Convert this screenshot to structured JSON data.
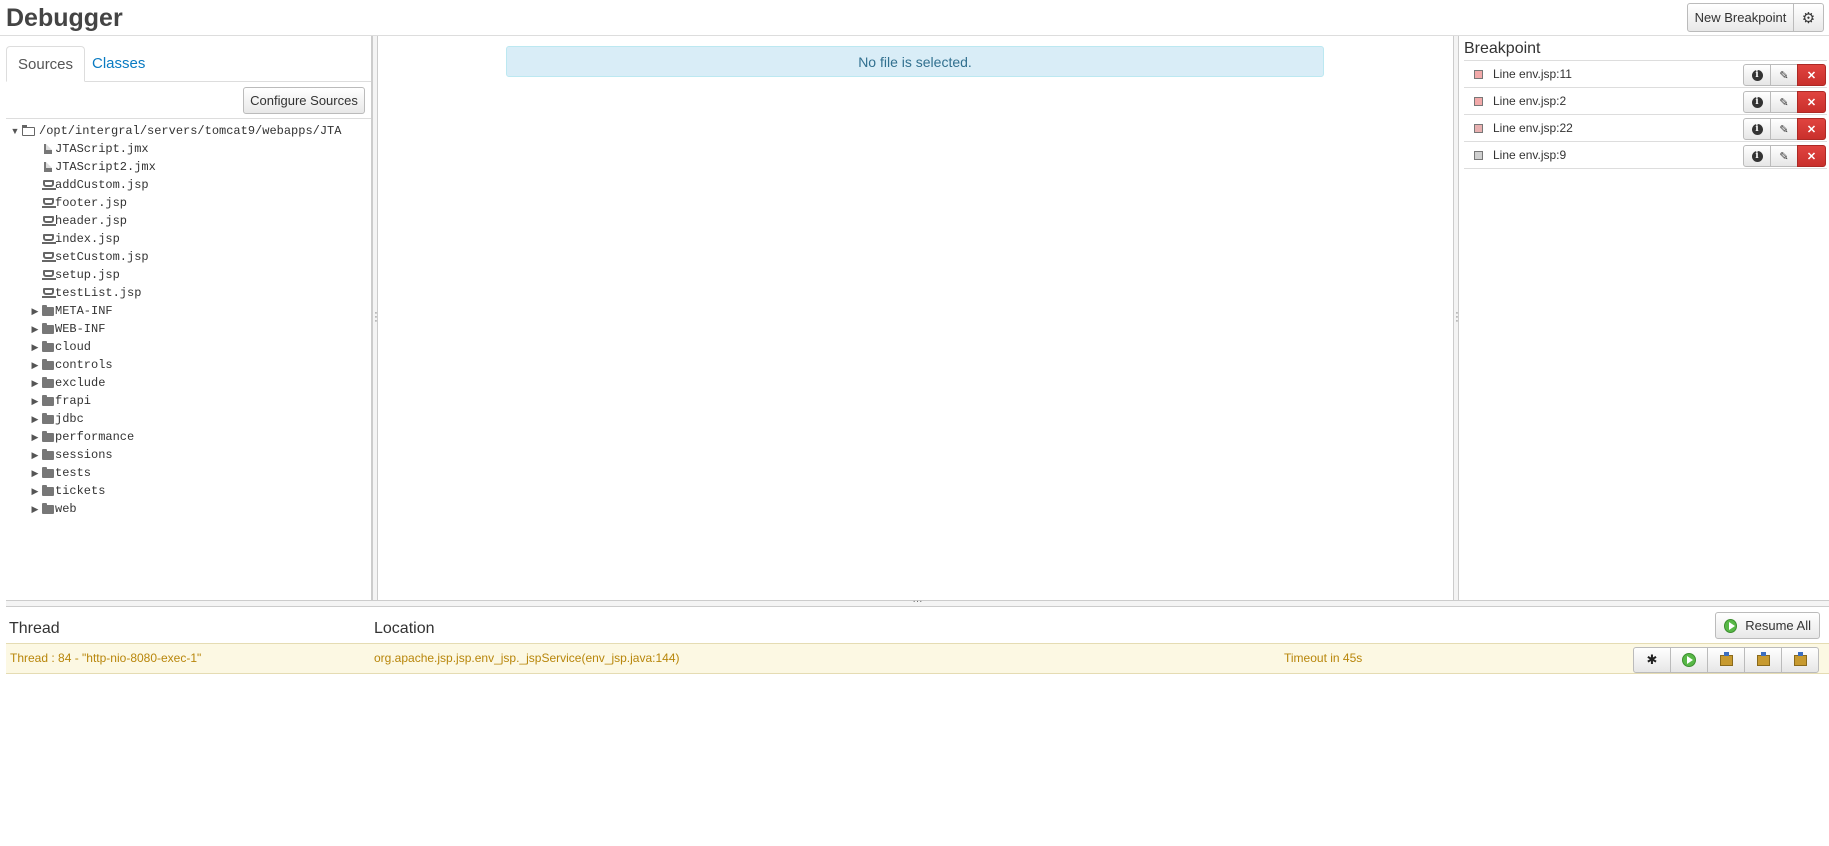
{
  "header": {
    "title": "Debugger",
    "new_breakpoint_label": "New Breakpoint",
    "settings_icon": "gear-icon"
  },
  "sources": {
    "tabs": [
      {
        "label": "Sources",
        "active": true
      },
      {
        "label": "Classes",
        "active": false
      }
    ],
    "configure_label": "Configure Sources",
    "tree": {
      "root": "/opt/intergral/servers/tomcat9/webapps/JTA",
      "files": [
        {
          "name": "JTAScript.jmx",
          "icon": "file-icon"
        },
        {
          "name": "JTAScript2.jmx",
          "icon": "file-icon"
        },
        {
          "name": "addCustom.jsp",
          "icon": "jsp-icon"
        },
        {
          "name": "footer.jsp",
          "icon": "jsp-icon"
        },
        {
          "name": "header.jsp",
          "icon": "jsp-icon"
        },
        {
          "name": "index.jsp",
          "icon": "jsp-icon"
        },
        {
          "name": "setCustom.jsp",
          "icon": "jsp-icon"
        },
        {
          "name": "setup.jsp",
          "icon": "jsp-icon"
        },
        {
          "name": "testList.jsp",
          "icon": "jsp-icon"
        }
      ],
      "folders": [
        "META-INF",
        "WEB-INF",
        "cloud",
        "controls",
        "exclude",
        "frapi",
        "jdbc",
        "performance",
        "sessions",
        "tests",
        "tickets",
        "web"
      ]
    }
  },
  "editor": {
    "empty_message": "No file is selected."
  },
  "breakpoints": {
    "header": "Breakpoint",
    "items": [
      {
        "label": "Line env.jsp:11",
        "state": "enabled",
        "marker_color": "#f2a9a9"
      },
      {
        "label": "Line env.jsp:2",
        "state": "enabled",
        "marker_color": "#f2a9a9"
      },
      {
        "label": "Line env.jsp:22",
        "state": "conditional",
        "marker_color": "#e8b0b0"
      },
      {
        "label": "Line env.jsp:9",
        "state": "disabled",
        "marker_color": "#cfcfcf"
      }
    ]
  },
  "threads": {
    "columns": {
      "thread": "Thread",
      "location": "Location"
    },
    "resume_all_label": "Resume All",
    "rows": [
      {
        "thread": "Thread : 84 - \"http-nio-8080-exec-1\"",
        "location": "org.apache.jsp.jsp.env_jsp._jspService(env_jsp.java:144)",
        "timeout": "Timeout in 45s"
      }
    ]
  }
}
